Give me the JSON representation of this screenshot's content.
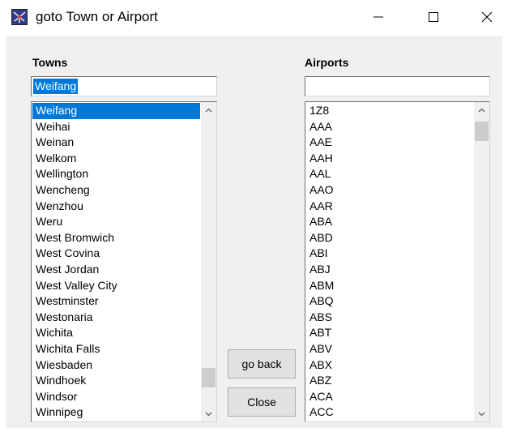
{
  "window": {
    "title": "goto Town or Airport",
    "controls": {
      "minimize": "—",
      "maximize": "☐",
      "close": "✕"
    }
  },
  "towns": {
    "label": "Towns",
    "input_value": "Weifang",
    "items": [
      "Weifang",
      "Weihai",
      "Weinan",
      "Welkom",
      "Wellington",
      "Wencheng",
      "Wenzhou",
      "Weru",
      "West Bromwich",
      "West Covina",
      "West Jordan",
      "West Valley City",
      "Westminster",
      "Westonaria",
      "Wichita",
      "Wichita Falls",
      "Wiesbaden",
      "Windhoek",
      "Windsor",
      "Winnipeg"
    ],
    "selected_index": 0
  },
  "airports": {
    "label": "Airports",
    "input_value": "",
    "items": [
      "1Z8",
      "AAA",
      "AAE",
      "AAH",
      "AAL",
      "AAO",
      "AAR",
      "ABA",
      "ABD",
      "ABI",
      "ABJ",
      "ABM",
      "ABQ",
      "ABS",
      "ABT",
      "ABV",
      "ABX",
      "ABZ",
      "ACA",
      "ACC"
    ]
  },
  "buttons": {
    "go_back": "go back",
    "close": "Close"
  },
  "colors": {
    "selection": "#0078d7",
    "dialog_bg": "#f0f0f0",
    "button_face": "#e1e1e1"
  }
}
